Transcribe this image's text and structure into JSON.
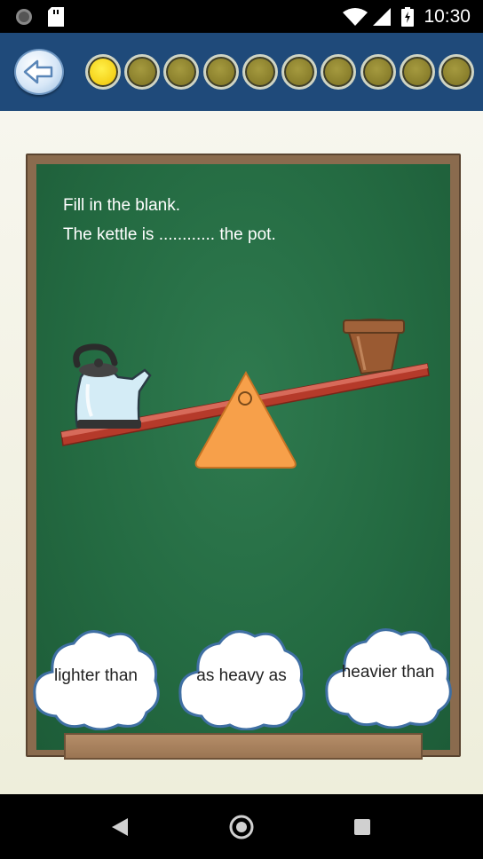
{
  "status_bar": {
    "time": "10:30"
  },
  "header": {
    "back_icon": "back-arrow-icon",
    "progress": {
      "total": 10,
      "current": 1
    },
    "colors": {
      "background": "#1f4a7a",
      "dot_active": "#f5d21b",
      "dot_inactive": "#8a7f2c"
    }
  },
  "question": {
    "line1": "Fill in the blank.",
    "line2": "The kettle is  ............ the pot."
  },
  "answers": [
    {
      "label": "lighter than"
    },
    {
      "label": "as heavy as"
    },
    {
      "label": "heavier than"
    }
  ],
  "illustration": {
    "icons": [
      "kettle-icon",
      "flower-pot-icon",
      "seesaw-icon"
    ]
  },
  "colors": {
    "board": "#246b42",
    "frame": "#8a6b4e",
    "plank": "#b53a2a",
    "fulcrum": "#f7a04a"
  }
}
